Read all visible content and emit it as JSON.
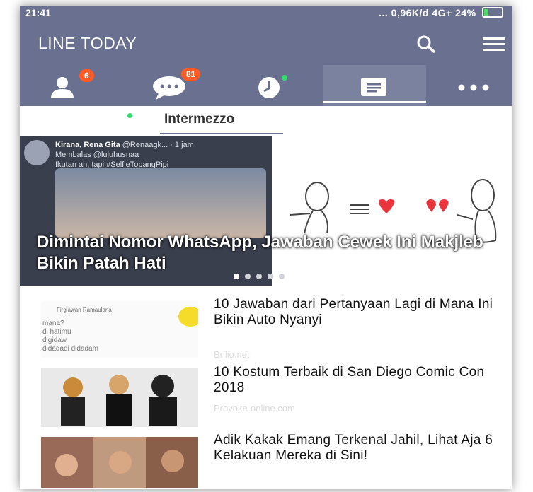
{
  "status_bar": {
    "time": "21:41",
    "right": "... 0,96K/d   4G+   24%"
  },
  "header": {
    "title": "LINE TODAY"
  },
  "nav_tabs": [
    {
      "name": "friends",
      "badge": "6"
    },
    {
      "name": "chats",
      "badge": "81"
    },
    {
      "name": "timeline",
      "badge": ""
    },
    {
      "name": "today",
      "badge": ""
    },
    {
      "name": "more",
      "badge": ""
    }
  ],
  "subtabs": {
    "active": "Intermezzo"
  },
  "hero": {
    "tweet_author": "Kirana, Rena Gita",
    "tweet_handle": "@Renaagk... · 1 jam",
    "tweet_reply": "Membalas @luluhusnaa",
    "tweet_text": "Ikutan ah, tapi #SelfieTopangPipi",
    "title": "Dimintai Nomor WhatsApp, Jawaban Cewek Ini Makjleb Bikin Patah Hati",
    "page_index": 0,
    "page_count": 5
  },
  "articles": [
    {
      "headline": "10 Jawaban dari Pertanyaan Lagi di Mana Ini Bikin Auto Nyanyi",
      "source": "Brilio.net"
    },
    {
      "headline": "10 Kostum Terbaik di San Diego Comic Con 2018",
      "source": "Provoke-online.com"
    },
    {
      "headline": "Adik Kakak Emang Terkenal Jahil, Lihat Aja 6 Kelakuan Mereka di Sini!",
      "source": ""
    }
  ],
  "thumb1_text": {
    "author": "Firgiawan Ramaulana",
    "lines": [
      "mana?",
      "di hatimu",
      "digidaw",
      "didadadi didadam"
    ]
  },
  "colors": {
    "header": "#6a7190",
    "badge": "#ff5b27",
    "online": "#2be06c"
  }
}
